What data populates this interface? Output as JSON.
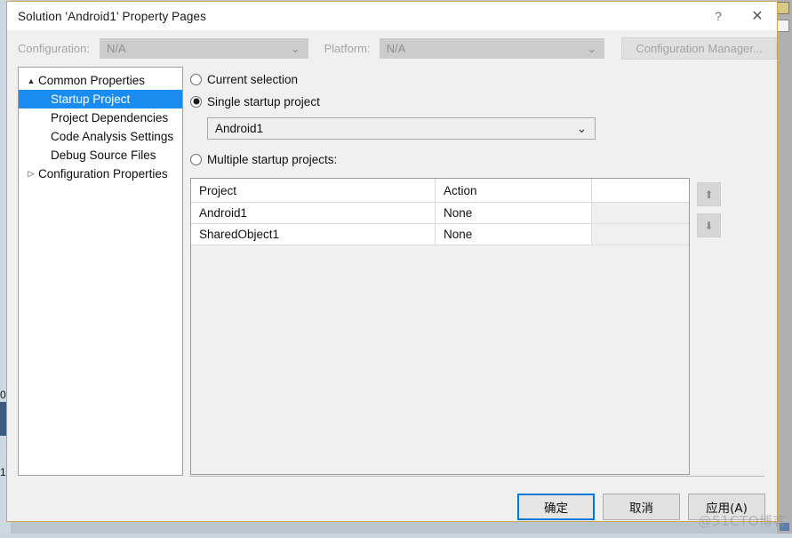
{
  "window": {
    "title": "Solution 'Android1' Property Pages",
    "help_button": "?",
    "close_button": "✕",
    "help_icon_name": "help-icon",
    "close_icon_name": "close-icon"
  },
  "config_bar": {
    "configuration_label": "Configuration:",
    "configuration_value": "N/A",
    "platform_label": "Platform:",
    "platform_value": "N/A",
    "configuration_manager_label": "Configuration Manager...",
    "chevron": "⌄"
  },
  "tree": {
    "nodes": [
      {
        "label": "Common Properties",
        "level": 0,
        "twisty": "▲",
        "expanded": true,
        "selected": false
      },
      {
        "label": "Startup Project",
        "level": 1,
        "twisty": "",
        "expanded": false,
        "selected": true
      },
      {
        "label": "Project Dependencies",
        "level": 1,
        "twisty": "",
        "expanded": false,
        "selected": false
      },
      {
        "label": "Code Analysis Settings",
        "level": 1,
        "twisty": "",
        "expanded": false,
        "selected": false
      },
      {
        "label": "Debug Source Files",
        "level": 1,
        "twisty": "",
        "expanded": false,
        "selected": false
      },
      {
        "label": "Configuration Properties",
        "level": 0,
        "twisty": "▷",
        "expanded": false,
        "selected": false
      }
    ]
  },
  "startup": {
    "option_current_selection": "Current selection",
    "option_single_startup": "Single startup project",
    "option_multiple_startup": "Multiple startup projects:",
    "selected_option": "single",
    "single_project_value": "Android1",
    "combo_chevron": "⌄"
  },
  "grid": {
    "columns": [
      "Project",
      "Action",
      ""
    ],
    "rows": [
      {
        "project": "Android1",
        "action": "None",
        "blank": ""
      },
      {
        "project": "SharedObject1",
        "action": "None",
        "blank": ""
      }
    ]
  },
  "reorder": {
    "move_up_glyph": "⬆",
    "move_down_glyph": "⬇",
    "move_up_name": "move-up-icon",
    "move_down_name": "move-down-icon"
  },
  "footer": {
    "ok_label": "确定",
    "cancel_label": "取消",
    "apply_label": "应用(A)"
  },
  "watermark": {
    "text": "@51CTO博客"
  },
  "backdrop": {
    "line_number_upper": "0",
    "line_number_lower": "1"
  },
  "colors": {
    "accent": "#0078d7",
    "selection": "#1a8cf0",
    "dialog_border": "#d2a24c",
    "dialog_bg": "#f0f0f0"
  }
}
